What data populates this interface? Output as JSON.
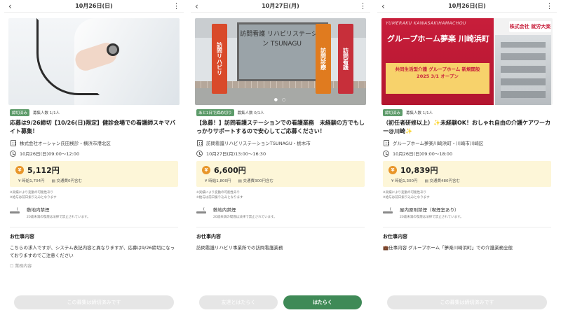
{
  "colors": {
    "accent_green": "#3f8a57",
    "badge_green": "#5d9b6a",
    "salary_bg": "#fdf6d8",
    "yen_orange": "#e8962a"
  },
  "common": {
    "salary_notes_1": "※実績により変動の可能性あり",
    "salary_notes_2": "※給与は前日振り込みとなります",
    "smoke_note": "20歳未満の喫煙は法律で禁止されています。",
    "work_content_heading": "お仕事内容",
    "apply_button": "はたらく",
    "favorite_button": "友達とはたらく"
  },
  "panels": [
    {
      "date": "10月26日(日)",
      "badge": "締切済み",
      "recruit": "募集人数 1/1人",
      "title": "応募は9/26締切【10/26(日)限定】健診会場での看護師スキマバイト募集！",
      "company": "株式会社オーシャン氏田検診・横浜市港北区",
      "time": "10月26日(日)09:00〜12:00",
      "salary": "5,112円",
      "hourly": "時給1,704円",
      "transport": "交通費0円含む",
      "smoking": "敷地内禁煙",
      "desc": "こちらの求人ですが、システム表記内容と異なりますが、応募は9/26締切になっておりますのでご注意ください",
      "fade": "業務内容",
      "closed_button": "この募集は締切済みです"
    },
    {
      "date": "10月27日(月)",
      "badge": "あと1日で締め切り",
      "recruit": "募集人数 0/1人",
      "title": "【急募！】訪問看護ステーションでの看護業務　未経験の方でもしっかりサポートするので安心してご応募ください！",
      "company": "訪問看護リハビリステーションTSUNAGU・栃木市",
      "time": "10月27日(月)13:00〜16:30",
      "salary": "6,600円",
      "hourly": "時給1,800円",
      "transport": "交通費300円含む",
      "smoking": "敷地内禁煙",
      "desc": "訪問看護リハビリ事業所での訪問看護業務",
      "hero_sign": "訪問看護 リハビリステーション TSUNAGU",
      "flag1": "訪問リハビリ",
      "flag2": "訪問診療",
      "flag3": "訪問看護"
    },
    {
      "date": "10月26日(日)",
      "badge": "締切済み",
      "recruit": "募集人数 1/1人",
      "title": "（初任者研修以上）✨未経験OK！おしゃれ自由の介護ケアワーカー@川崎✨",
      "company": "グループホーム夢楽川崎浜町・川崎市川崎区",
      "time": "10月26日(日)09:00〜18:00",
      "salary": "10,839円",
      "hourly": "時給1,300円",
      "transport": "交通費480円含む",
      "smoking": "屋内原則禁煙（喫煙室あり）",
      "desc": "💼仕事内容 グループホーム「夢楽川崎浜町」での介護業務全般",
      "closed_button": "この募集は締切済みです",
      "hero_watermark": "YUMERAKU KAWASAKIHAMACHOU",
      "hero_title": "グループホーム夢楽 川崎浜町",
      "hero_banner": "共同生活型介護 グループホーム 新規開設 2025 3/1 オープン",
      "hero_logo": "株式会社 就労大楽"
    }
  ]
}
